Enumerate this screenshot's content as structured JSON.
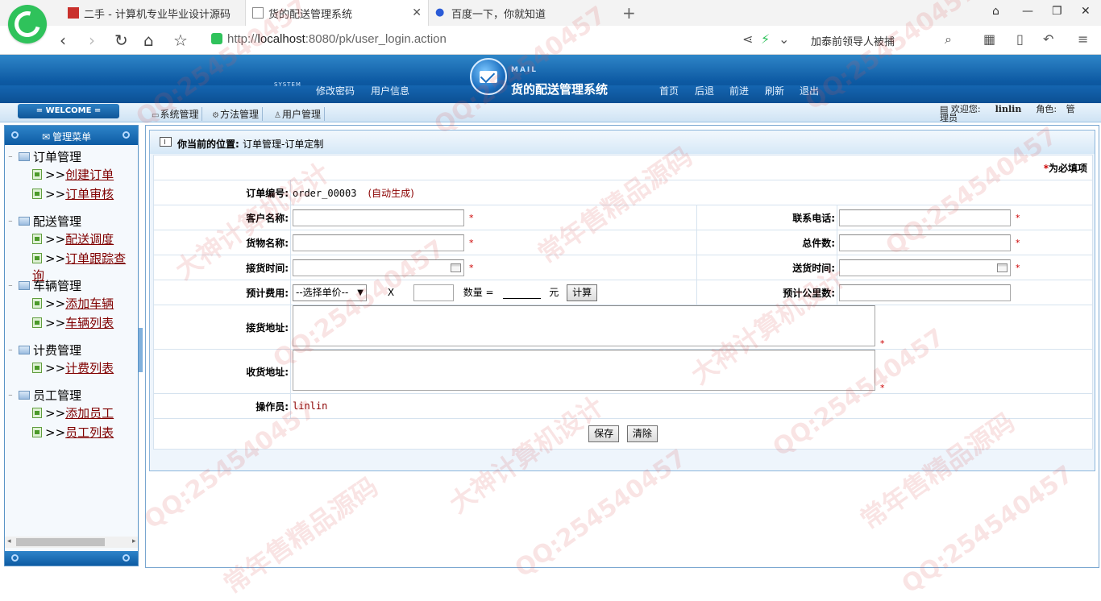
{
  "browser": {
    "tabs": [
      {
        "title": "二手 - 计算机专业毕业设计源码"
      },
      {
        "title": "货的配送管理系统"
      },
      {
        "title": "百度一下，你就知道"
      }
    ],
    "url_scheme": "http://",
    "url_host": "localhost",
    "url_path": ":8080/pk/user_login.action",
    "hot_search": "加泰前领导人被捕",
    "new_tab": "+"
  },
  "header": {
    "system_label": "SYSTEM",
    "nav_left": [
      "修改密码",
      "用户信息"
    ],
    "logo_word": "MAIL",
    "title": "货的配送管理系统",
    "nav_right": [
      "首页",
      "后退",
      "前进",
      "刷新",
      "退出"
    ]
  },
  "topbar": {
    "welcome": "= WELCOME =",
    "menus": [
      "系统管理",
      "方法管理",
      "用户管理"
    ],
    "welcome_user_label": "欢迎您:",
    "username": "linlin",
    "role_label": "角色:",
    "role_cut1": "管",
    "role_cut2": "理员"
  },
  "sidebar": {
    "title": "管理菜单",
    "groups": [
      {
        "label": "订单管理",
        "items": [
          "创建订单",
          "订单审核"
        ]
      },
      {
        "label": "配送管理",
        "items": [
          "配送调度",
          "订单跟踪查询"
        ]
      },
      {
        "label": "车辆管理",
        "items": [
          "添加车辆",
          "车辆列表"
        ]
      },
      {
        "label": "计费管理",
        "items": [
          "计费列表"
        ]
      },
      {
        "label": "员工管理",
        "items": [
          "添加员工",
          "员工列表"
        ]
      }
    ],
    "item_prefix": ">>"
  },
  "main": {
    "crumb_label": "你当前的位置:",
    "crumb_path": "订单管理-订单定制",
    "required_note": "为必填项",
    "required_mark": "*",
    "form": {
      "order_no_label": "订单编号:",
      "order_no": "order_00003",
      "auto_note": "(自动生成)",
      "customer_label": "客户名称:",
      "phone_label": "联系电话:",
      "goods_label": "货物名称:",
      "total_label": "总件数:",
      "pickup_time_label": "接货时间:",
      "delivery_time_label": "送货时间:",
      "cost_label": "预计费用:",
      "price_select": "--选择单价--",
      "times": "X",
      "qty_label": "数量 =",
      "yuan": "元",
      "calc_button": "计算",
      "km_label": "预计公里数:",
      "pickup_addr_label": "接货地址:",
      "receive_addr_label": "收货地址:",
      "operator_label": "操作员:",
      "operator": "linlin",
      "save_button": "保存",
      "clear_button": "清除"
    }
  },
  "watermarks": {
    "qq": "QQ:254540457",
    "t1": "大神计算机设计",
    "t2": "常年售精品源码"
  }
}
